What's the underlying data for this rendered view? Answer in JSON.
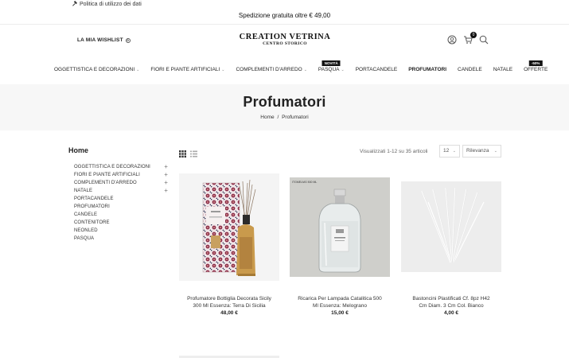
{
  "topbar": {
    "privacy_link": "Politica di utilizzo dei dati"
  },
  "shipping": {
    "text": "Spedizione gratuita oltre € 49,00"
  },
  "header": {
    "wishlist_label": "LA MIA WISHLIST",
    "wishlist_count": "0",
    "logo_title": "CREATION VETRINA",
    "logo_subtitle": "CENTRO STORICO",
    "cart_count": "0"
  },
  "nav": {
    "items": [
      {
        "label": "OGGETTISTICA E DECORAZIONI",
        "caret": "⌄"
      },
      {
        "label": "FIORI E PIANTE ARTIFICIALI",
        "caret": "⌄"
      },
      {
        "label": "COMPLEMENTI D'ARREDO",
        "caret": "⌄"
      },
      {
        "label": "PASQUA",
        "caret": "⌄",
        "badge": "NOVITÀ"
      },
      {
        "label": "PORTACANDELE"
      },
      {
        "label": "PROFUMATORI"
      },
      {
        "label": "CANDELE"
      },
      {
        "label": "NATALE"
      },
      {
        "label": "OFFERTE",
        "badge": "-50%"
      }
    ]
  },
  "hero": {
    "title": "Profumatori",
    "breadcrumb_home": "Home",
    "breadcrumb_sep": "/",
    "breadcrumb_current": "Profumatori"
  },
  "sidebar": {
    "title": "Home",
    "categories": [
      {
        "label": "OGGETTISTICA E DECORAZIONI",
        "expand": "+"
      },
      {
        "label": "FIORI E PIANTE ARTIFICIALI",
        "expand": "+"
      },
      {
        "label": "COMPLEMENTI D'ARREDO",
        "expand": "+"
      },
      {
        "label": "NATALE",
        "expand": "+"
      },
      {
        "label": "PORTACANDELE"
      },
      {
        "label": "PROFUMATORI"
      },
      {
        "label": "CANDELE"
      },
      {
        "label": "CONTENITORE"
      },
      {
        "label": "NEONLED"
      },
      {
        "label": "PASQUA"
      }
    ]
  },
  "toolbar": {
    "results_text": "Visualizzati 1-12 su 35 articoli",
    "per_page": "12",
    "sort": "Rilevanza"
  },
  "products": [
    {
      "name": "Profumatore Bottiglia Decorata Sicily 300 Ml Essenza: Terra Di Sicilia",
      "price": "48,00 €"
    },
    {
      "name": "Ricarica Per Lampada Catalitica 500 Ml Essenza: Melograno",
      "price": "15,00 €",
      "img_label": "ITGMELMG 500 ML"
    },
    {
      "name": "Bastoncini Plastificati Cf. 8pz H42 Cm Diam. 3 Cm Col. Bianco",
      "price": "4,00 €"
    }
  ]
}
